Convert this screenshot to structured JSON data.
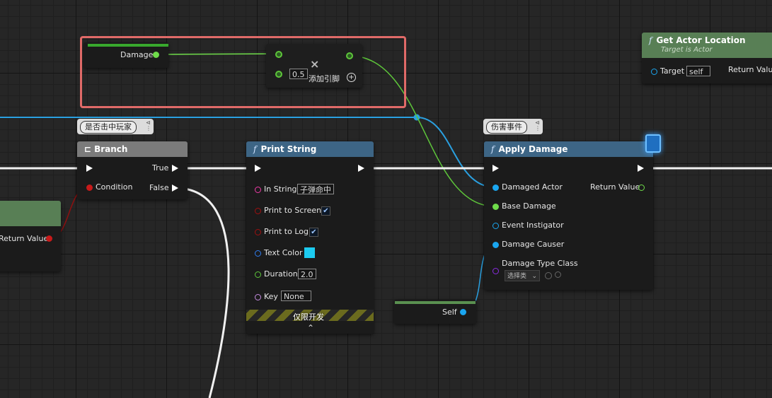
{
  "colors": {
    "selection": "#e06a68",
    "float_pin": "#6fdc4a",
    "object_pin": "#1aa6f0",
    "bool_pin": "#c81a1a",
    "string_pin": "#ef3aa8",
    "linear_color_pin": "#2f7cf0",
    "class_pin": "#8a2be2",
    "name_pin": "#c48be0",
    "text_color_swatch": "#1ccbf0"
  },
  "damage_var": {
    "label": "Damage"
  },
  "add_node": {
    "value": "0.5",
    "close_glyph": "×",
    "add_pin_label": "添加引脚"
  },
  "get_actor_location": {
    "title": "Get Actor Location",
    "subtitle": "Target is Actor",
    "target_label": "Target",
    "target_value": "self",
    "return_label": "Return Value"
  },
  "comments": {
    "branch": "是否击中玩家",
    "apply": "伤害事件"
  },
  "branch": {
    "title": "Branch",
    "condition_label": "Condition",
    "true_label": "True",
    "false_label": "False"
  },
  "left_node": {
    "return_label": "Return Value"
  },
  "print_string": {
    "title": "Print String",
    "in_string_label": "In String",
    "in_string_value": "子弹命中",
    "print_to_screen_label": "Print to Screen",
    "print_to_screen": true,
    "print_to_log_label": "Print to Log",
    "print_to_log": true,
    "text_color_label": "Text Color",
    "duration_label": "Duration",
    "duration_value": "2.0",
    "key_label": "Key",
    "key_value": "None",
    "dev_only_label": "仅限开发",
    "expand_glyph": "⌃"
  },
  "apply_damage": {
    "title": "Apply Damage",
    "damaged_actor_label": "Damaged Actor",
    "base_damage_label": "Base Damage",
    "event_instigator_label": "Event Instigator",
    "damage_causer_label": "Damage Causer",
    "damage_type_class_label": "Damage Type Class",
    "damage_type_select": "选择类",
    "return_label": "Return Value"
  },
  "self_node": {
    "label": "Self"
  }
}
